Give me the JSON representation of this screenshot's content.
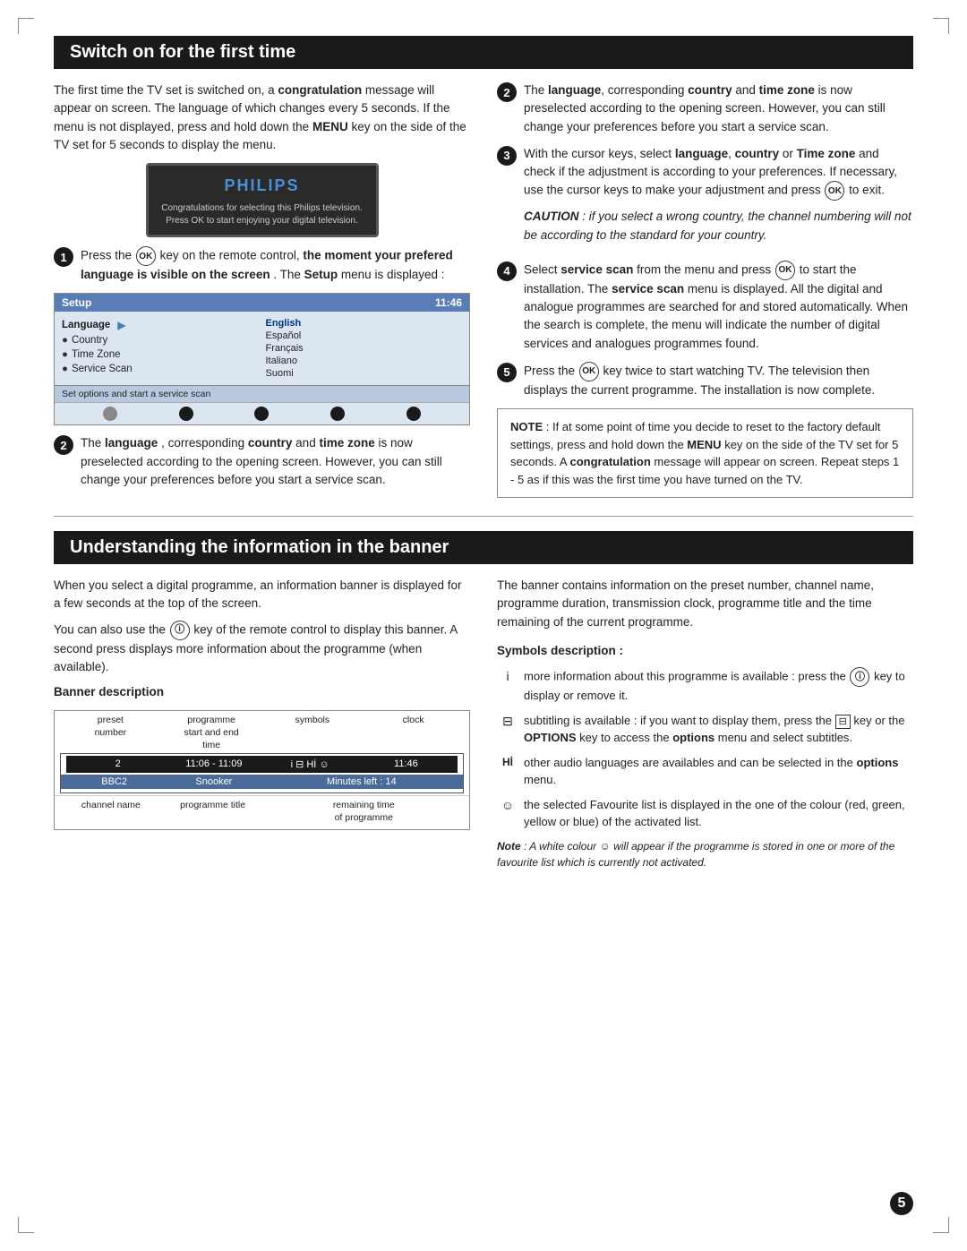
{
  "page": {
    "number": "5"
  },
  "section1": {
    "title": "Switch on for the first time",
    "left_col": {
      "intro": "The first time the TV set is switched on, a",
      "intro_bold": "congratulation",
      "intro_rest": " message will appear on screen. The language of which changes every 5 seconds. If the menu is not displayed, press and hold down the",
      "menu_key": "MENU",
      "intro_rest2": " key on the side of the TV set for 5 seconds to display the menu.",
      "philips_logo": "PHILIPS",
      "tv_line1": "Congratulations for selecting this Philips television.",
      "tv_line2": "Press OK to start enjoying your digital television.",
      "step1_text": "Press the",
      "step1_ok": "OK",
      "step1_rest": " key on the remote control,",
      "step1_bold": "the moment your prefered language is visible on the screen",
      "step1_end": ". The",
      "step1_setup": "Setup",
      "step1_end2": " menu is displayed :",
      "setup_title": "Setup",
      "setup_time": "11:46",
      "menu_language": "Language",
      "menu_country": "Country",
      "menu_timezone": "Time Zone",
      "menu_servicescan": "Service Scan",
      "lang_english": "English",
      "lang_espanol": "Español",
      "lang_francais": "Français",
      "lang_italiano": "Italiano",
      "lang_suomi": "Suomi",
      "setup_footer": "Set options and start a service scan",
      "step2_text": "The",
      "step2_bold1": "language",
      "step2_rest1": ", corresponding",
      "step2_bold2": "country",
      "step2_rest2": " and",
      "step2_bold3": "time zone",
      "step2_rest3": " is now preselected according to the opening screen. However, you can still change your preferences before you start a service scan."
    },
    "right_col": {
      "step2b_text": "The",
      "step2b_bold1": "language",
      "step2b_rest1": ", corresponding",
      "step2b_bold2": "country",
      "step2b_rest2": " and",
      "step2b_bold3": "time zone",
      "step2b_rest3": " is now preselected according to the opening screen. However, you can still change your preferences before you start a service scan.",
      "step3_text": "With the cursor keys, select",
      "step3_bold1": "language",
      "step3_sep": ",",
      "step3_bold2": "country",
      "step3_rest1": " or",
      "step3_bold3": "Time zone",
      "step3_rest2": " and check if the adjustment is according to your preferences. If necessary, use the cursor keys to make your adjustment and press",
      "step3_ok": "OK",
      "step3_end": " to exit.",
      "caution_word": "CAUTION",
      "caution_text": " : if you select a wrong country, the channel numbering will not be according to the standard for your country.",
      "step4_text": "Select",
      "step4_bold1": "service scan",
      "step4_rest1": " from the menu and press",
      "step4_ok": "OK",
      "step4_rest2": " to start the installation. The",
      "step4_bold2": "service scan",
      "step4_rest3": " menu is displayed. All the digital and analogue programmes are searched for and stored automatically. When the search is complete, the menu will indicate the number of digital services and analogues programmes found.",
      "step5_text": "Press the",
      "step5_ok": "OK",
      "step5_rest": " key twice to start watching TV. The television then displays the current programme. The installation is now complete.",
      "note_title": "NOTE",
      "note_text": " : If at some point of time you decide to reset to the factory default settings, press and hold down the",
      "note_bold1": "MENU",
      "note_rest1": " key on the side of the TV set for 5 seconds. A",
      "note_bold2": "congratulation",
      "note_rest2": " message will appear on screen. Repeat steps 1 - 5 as if this was the first time you have turned on the TV."
    }
  },
  "section2": {
    "title": "Understanding the information in the banner",
    "left_col": {
      "para1": "When you select a digital programme, an information banner is displayed for a few seconds at the top of the screen.",
      "para2_pre": "You can also use the",
      "para2_icon": "ⓘ",
      "para2_rest": " key of the remote control to display this banner. A second press displays more information about the programme (when available).",
      "banner_desc_title": "Banner description",
      "label_preset": "preset",
      "label_number": "number",
      "label_programme": "programme",
      "label_startend": "start and end",
      "label_time": "time",
      "label_symbols": "symbols",
      "label_clock": "clock",
      "data_2": "2",
      "data_time": "11:06 - 11:09",
      "data_symbols": "i  ⊟  Hİ  ☺",
      "data_clock": "11:46",
      "data_bbc2": "BBC2",
      "data_snooker": "Snooker",
      "data_minutes": "Minutes left : 14",
      "label_channel": "channel name",
      "label_progtitle": "programme title",
      "label_remaining": "remaining time",
      "label_ofprog": "of programme"
    },
    "right_col": {
      "para1": "The banner contains information on the preset number, channel name, programme duration, transmission clock, programme title and the time remaining of the current programme.",
      "symbols_title": "Symbols description :",
      "sym_i_text": "more information about this programme is available : press the",
      "sym_i_icon": "ⓘ",
      "sym_i_rest": " key to display or remove it.",
      "sym_sub_pre": "subtitling is available : if you want to display them, press the",
      "sym_sub_icon1": "⊟",
      "sym_sub_mid": " key or the",
      "sym_sub_bold": "OPTIONS",
      "sym_sub_rest": " key to access the",
      "sym_sub_bold2": "options",
      "sym_sub_rest2": " menu and select subtitles.",
      "sym_hi_text": "other audio languages are availables and can be selected in the",
      "sym_hi_bold": "options",
      "sym_hi_rest": " menu.",
      "sym_smiley_pre": "the selected Favourite list is displayed in the one of the colour (red, green, yellow or blue) of the activated list.",
      "note_italic": "Note",
      "note_rest": " : A white colour",
      "note_icon": "☺",
      "note_rest2": " will appear if the programme is stored in one or more of the favourite list which is currently not activated."
    }
  }
}
